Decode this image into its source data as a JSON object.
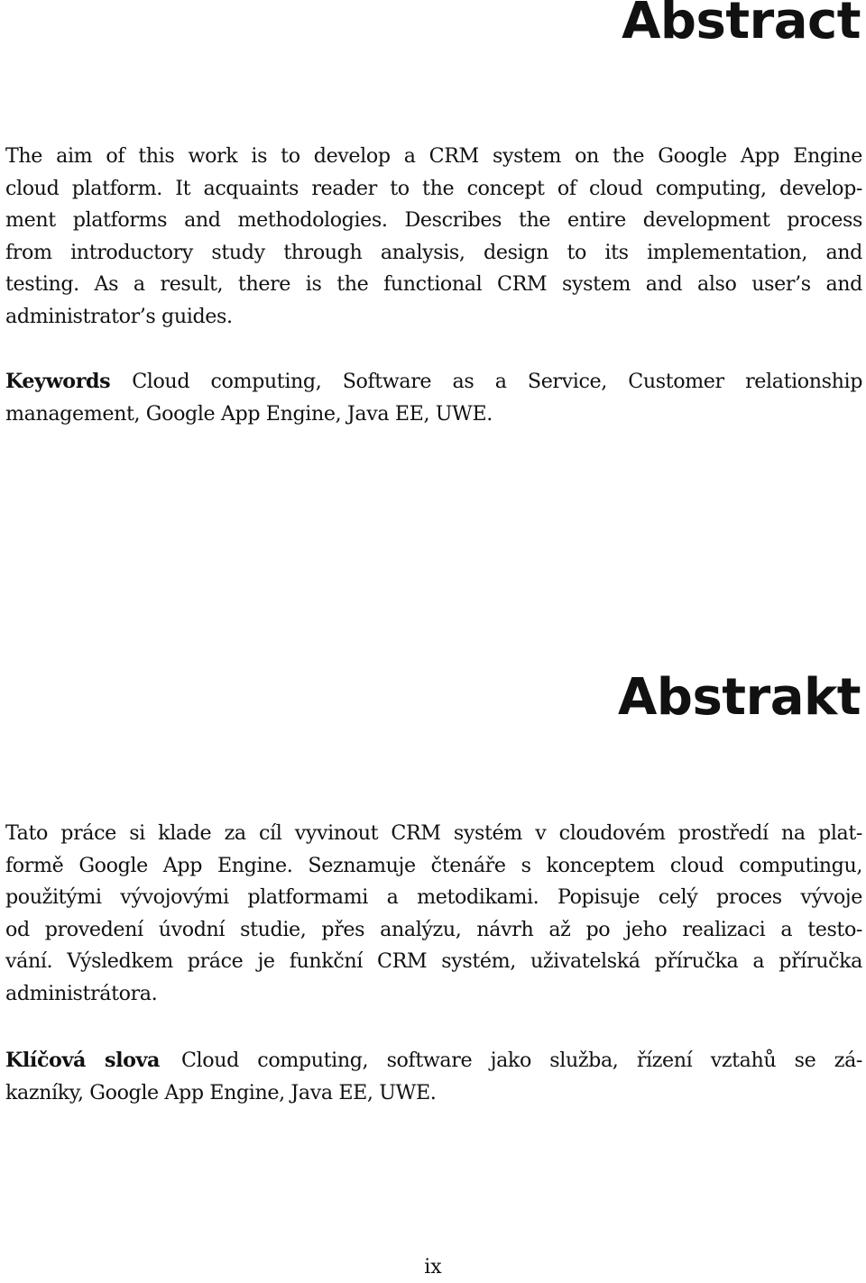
{
  "abstract_en": {
    "heading": "Abstract",
    "lines": [
      "The aim of this work is to develop a CRM system on the Google App Engine",
      "cloud platform. It acquaints reader to the concept of cloud computing, develop-",
      "ment platforms and methodologies. Describes the entire development process",
      "from introductory study through analysis, design to its implementation, and",
      "testing. As a result, there is the functional CRM system and also user’s and",
      "administrator’s guides."
    ],
    "keywords_label": "Keywords",
    "keywords_lines": [
      "Cloud computing, Software as a Service, Customer relationship",
      "management, Google App Engine, Java EE, UWE."
    ]
  },
  "abstract_cz": {
    "heading": "Abstrakt",
    "lines": [
      "Tato práce si klade za cíl vyvinout CRM systém v cloudovém prostředí na plat-",
      "formě Google App Engine. Seznamuje čtenáře s konceptem cloud computingu,",
      "použitými vývojovými platformami a metodikami. Popisuje celý proces vývoje",
      "od provedení úvodní studie, přes analýzu, návrh až po jeho realizaci a testo-",
      "vání. Výsledkem práce je funkční CRM systém, uživatelská příručka a příručka",
      "administrátora."
    ],
    "keywords_label": "Klíčová slova",
    "keywords_lines": [
      "Cloud computing, software jako služba, řízení vztahů se zá-",
      "kazníky, Google App Engine, Java EE, UWE."
    ]
  },
  "page_number": "ix"
}
